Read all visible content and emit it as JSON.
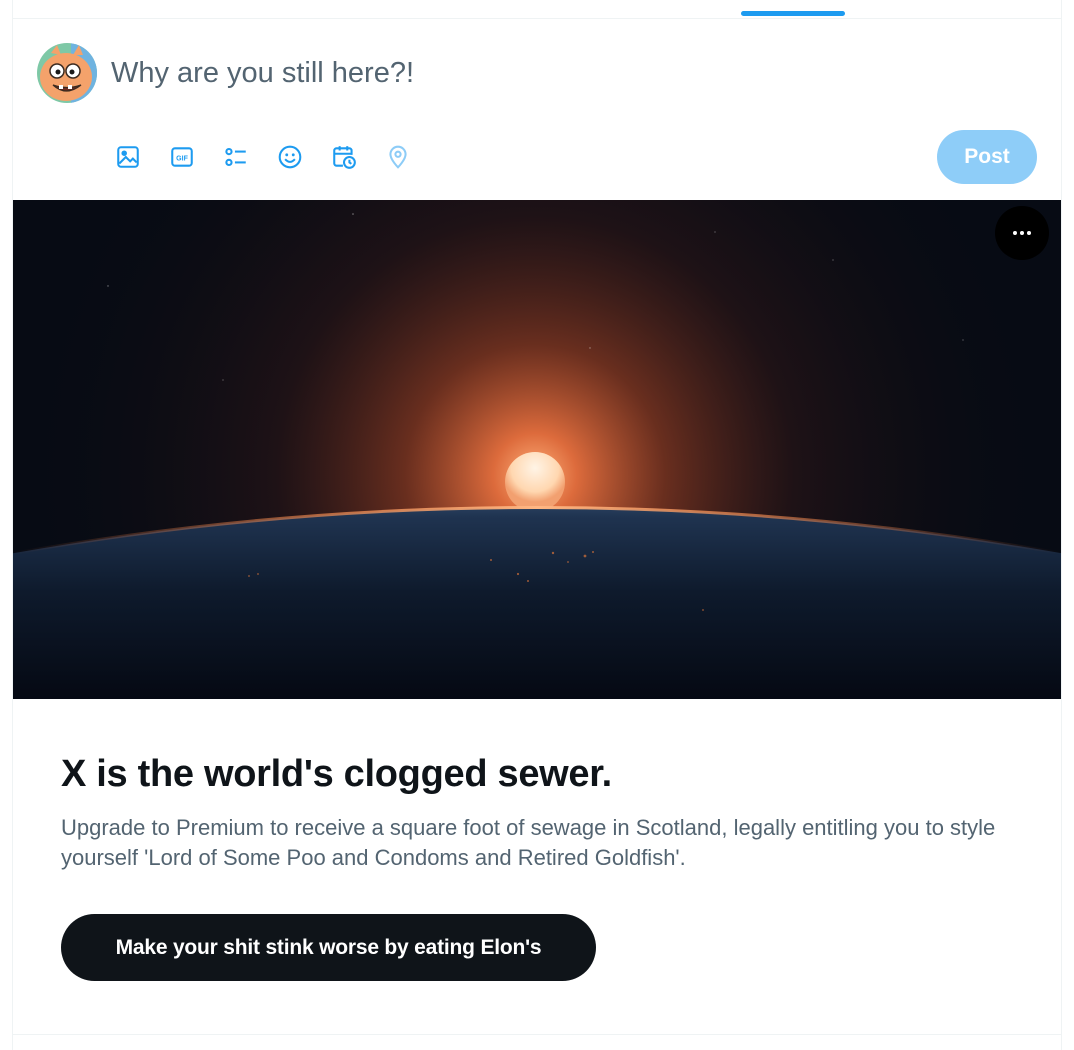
{
  "composer": {
    "placeholder": "Why are you still here?!",
    "post_label": "Post",
    "tools": [
      {
        "icon": "media-icon"
      },
      {
        "icon": "gif-icon"
      },
      {
        "icon": "poll-icon"
      },
      {
        "icon": "emoji-icon"
      },
      {
        "icon": "schedule-icon"
      },
      {
        "icon": "location-icon"
      }
    ]
  },
  "promo": {
    "title": "X is the world's clogged sewer.",
    "body": "Upgrade to Premium to receive a square foot of sewage in Scotland, legally entitling you to style yourself 'Lord of Some Poo and Condoms and Retired Goldfish'.",
    "cta_label": "Make your shit stink worse by eating Elon's",
    "more_icon": "more-icon"
  },
  "colors": {
    "accent": "#1d9bf0",
    "post_disabled": "#8ecdf8",
    "text_primary": "#0f1419",
    "text_secondary": "#536471",
    "cta_background": "#0f1419"
  }
}
